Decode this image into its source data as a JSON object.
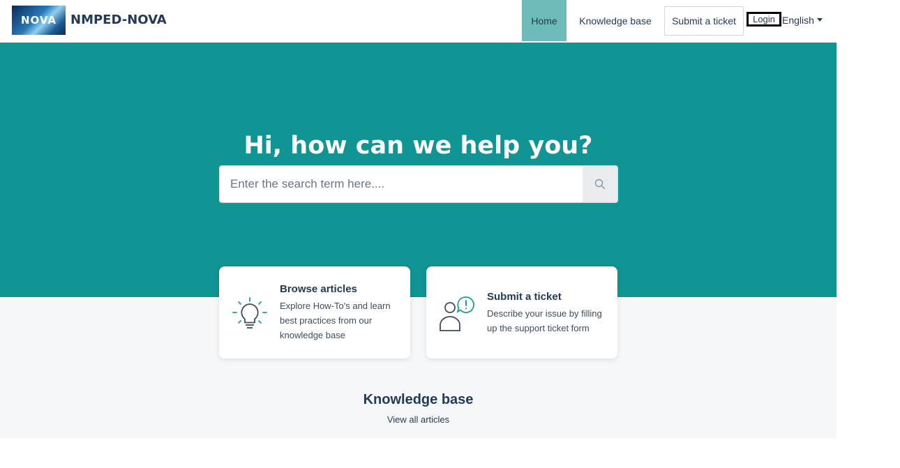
{
  "header": {
    "logo_text": "NOVA",
    "brand": "NMPED-NOVA",
    "nav": {
      "home": "Home",
      "knowledge_base": "Knowledge base",
      "submit_ticket": "Submit a ticket",
      "login": "Login",
      "language": "English"
    }
  },
  "hero": {
    "title": "Hi, how can we help you?",
    "search_placeholder": "Enter the search term here...."
  },
  "cards": [
    {
      "title": "Browse articles",
      "description": "Explore How-To's and learn best practices from our knowledge base",
      "icon": "lightbulb-icon"
    },
    {
      "title": "Submit a ticket",
      "description": "Describe your issue by filling up the support ticket form",
      "icon": "user-alert-icon"
    }
  ],
  "knowledge_base": {
    "title": "Knowledge base",
    "link": "View all articles"
  },
  "colors": {
    "hero": "#119494",
    "nav_active": "#6ebcba",
    "text": "#233a56",
    "accent": "#1a9e94"
  }
}
